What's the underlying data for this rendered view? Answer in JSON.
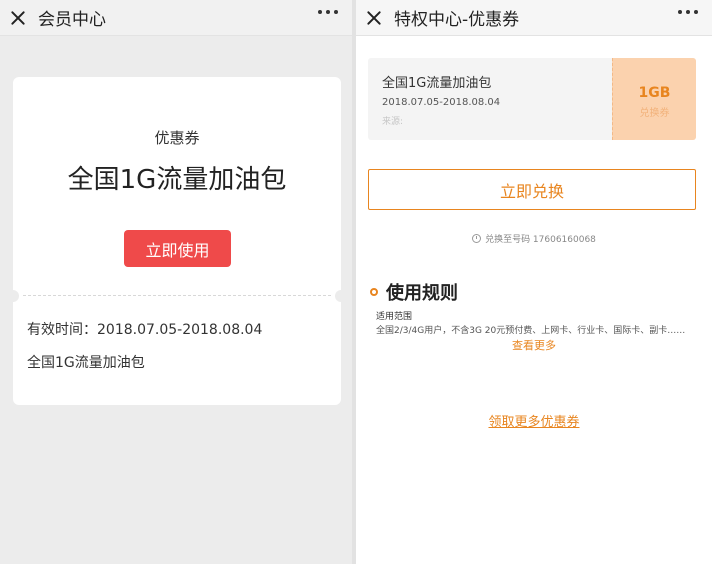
{
  "left": {
    "header": {
      "title": "会员中心"
    },
    "card": {
      "type": "优惠券",
      "name": "全国1G流量加油包",
      "use_label": "立即使用",
      "validity": "有效时间：2018.07.05-2018.08.04",
      "description": "全国1G流量加油包"
    }
  },
  "right": {
    "header": {
      "title": "特权中心-优惠券"
    },
    "coupon": {
      "name": "全国1G流量加油包",
      "date_range": "2018.07.05-2018.08.04",
      "source": "来源:",
      "amount": "1GB",
      "exchange_label": "兑换券"
    },
    "redeem_label": "立即兑换",
    "redeem_to": "兑换至号码 17606160068",
    "rules": {
      "title": "使用规则",
      "scope_label": "适用范围",
      "scope_text": "全国2/3/4G用户，不含3G 20元预付费、上网卡、行业卡、国际卡、副卡……",
      "see_more": "查看更多"
    },
    "more_coupons": "领取更多优惠券"
  },
  "colors": {
    "accent_red": "#ef4a4a",
    "accent_orange": "#e8851f",
    "stub_bg": "#fbd2ae"
  }
}
